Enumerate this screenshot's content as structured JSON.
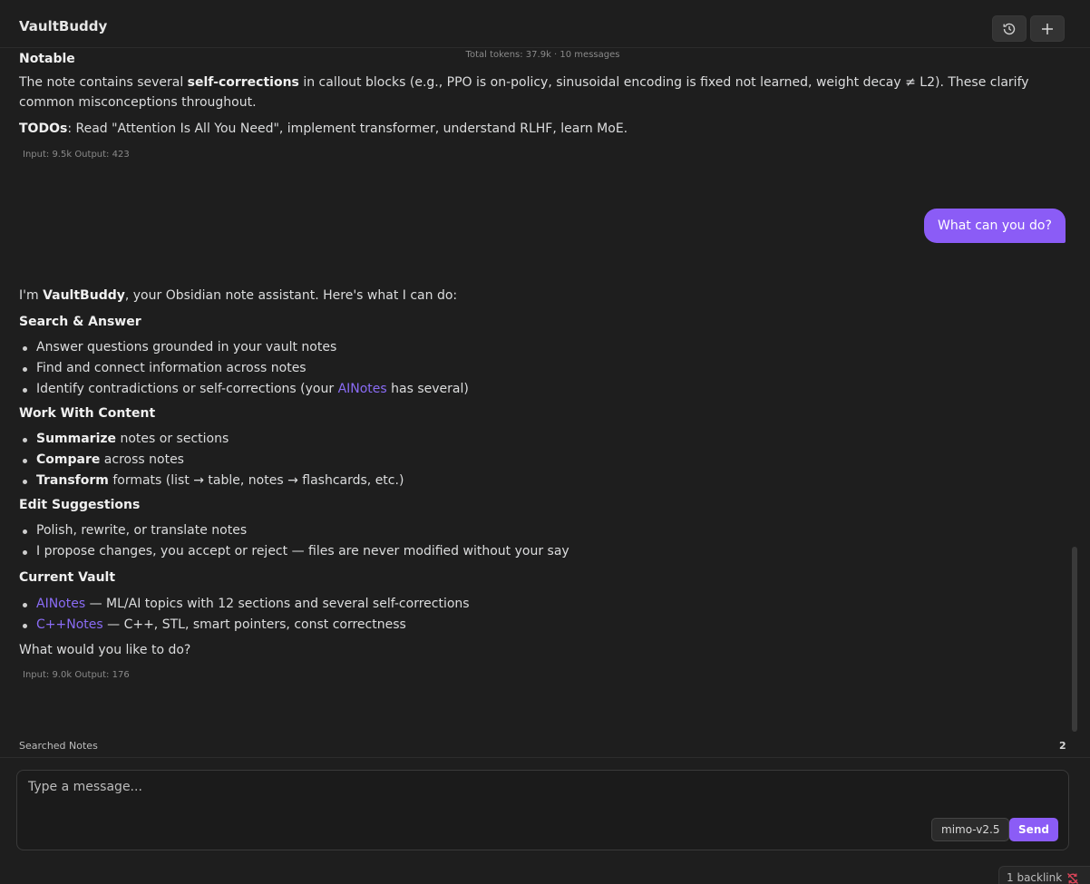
{
  "app": {
    "title": "VaultBuddy"
  },
  "header": {
    "history_icon": "history-icon",
    "new_chat_icon": "plus-icon",
    "token_summary": "Total tokens: 37.9k · 10 messages"
  },
  "messages": {
    "assistant1": {
      "heading_partial": "Notable",
      "para1_pre": "The note contains several ",
      "para1_bold": "self-corrections",
      "para1_post": " in callout blocks (e.g., PPO is on-policy, sinusoidal encoding is fixed not learned, weight decay ≠ L2). These clarify common misconceptions throughout.",
      "todos_label": "TODOs",
      "todos_text": ": Read \"Attention Is All You Need\", implement transformer, understand RLHF, learn MoE.",
      "usage": "Input: 9.5k Output: 423"
    },
    "user1": {
      "text": "What can you do?"
    },
    "assistant2": {
      "intro_pre": "I'm ",
      "intro_bold": "VaultBuddy",
      "intro_post": ", your Obsidian note assistant. Here's what I can do:",
      "sections": {
        "search": {
          "heading": "Search & Answer",
          "item1": "Answer questions grounded in your vault notes",
          "item2": "Find and connect information across notes",
          "item3_pre": "Identify contradictions or self-corrections (your ",
          "item3_link": "AINotes",
          "item3_post": " has several)"
        },
        "work": {
          "heading": "Work With Content",
          "item1_bold": "Summarize",
          "item1_text": " notes or sections",
          "item2_bold": "Compare",
          "item2_text": " across notes",
          "item3_bold": "Transform",
          "item3_text": " formats (list → table, notes → flashcards, etc.)"
        },
        "edit": {
          "heading": "Edit Suggestions",
          "item1": "Polish, rewrite, or translate notes",
          "item2": "I propose changes, you accept or reject — files are never modified without your say"
        },
        "vault": {
          "heading": "Current Vault",
          "item1_link": "AINotes",
          "item1_text": " — ML/AI topics with 12 sections and several self-corrections",
          "item2_link": "C++Notes",
          "item2_text": " — C++, STL, smart pointers, const correctness"
        }
      },
      "closing": "What would you like to do?",
      "usage": "Input: 9.0k Output: 176"
    }
  },
  "searched_notes": {
    "label": "Searched Notes",
    "count": "2"
  },
  "composer": {
    "placeholder": "Type a message...",
    "model": "mimo-v2.5",
    "send": "Send"
  },
  "status_bar": {
    "backlinks": "1 backlink",
    "sync_icon": "sync-disabled-icon"
  },
  "colors": {
    "accent": "#8b5cf6",
    "link": "#8a6cf5",
    "background": "#1e1e1e"
  }
}
